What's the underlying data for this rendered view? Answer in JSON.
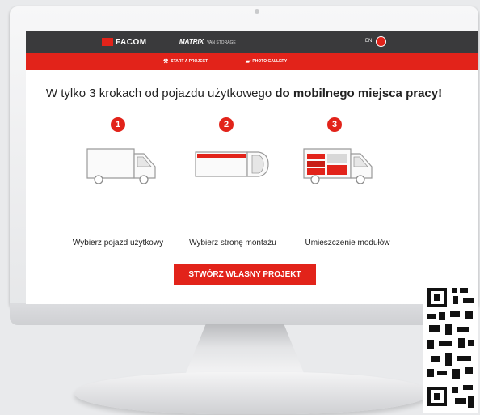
{
  "header": {
    "brand": "FACOM",
    "product": "MATRIX",
    "product_sub": "VAN STORAGE",
    "language": "EN"
  },
  "subnav": {
    "items": [
      {
        "label": "START A PROJECT",
        "icon": "ruler-icon"
      },
      {
        "label": "PHOTO GALLERY",
        "icon": "truck-icon"
      }
    ]
  },
  "main": {
    "headline_normal": "W tylko 3 krokach od pojazdu użytkowego ",
    "headline_bold": "do mobilnego miejsca pracy!",
    "steps": [
      {
        "number": "1",
        "label": "Wybierz pojazd użytkowy"
      },
      {
        "number": "2",
        "label": "Wybierz stronę montażu"
      },
      {
        "number": "3",
        "label": "Umieszczenie modułów"
      }
    ],
    "cta_label": "STWÓRZ WŁASNY PROJEKT"
  },
  "colors": {
    "accent": "#e2231a",
    "header_bg": "#3a3a3c"
  }
}
